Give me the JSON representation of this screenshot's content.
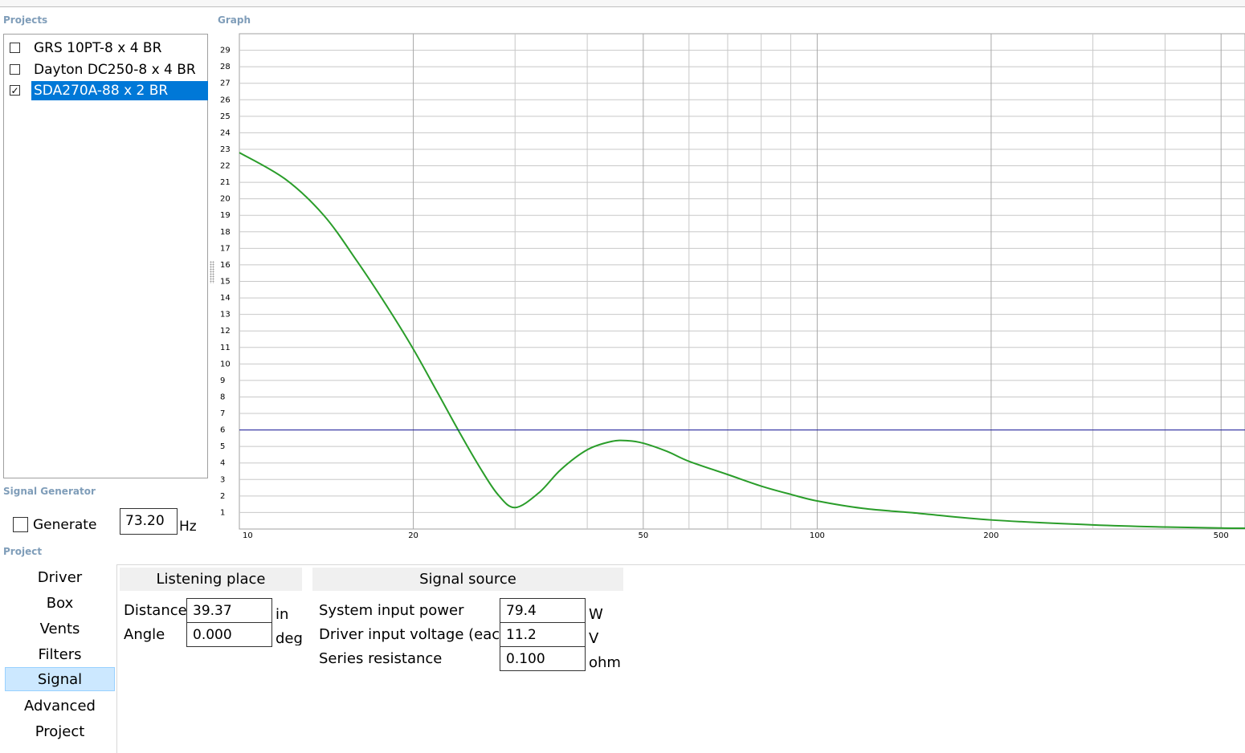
{
  "projects_panel": {
    "title": "Projects",
    "items": [
      {
        "label": "GRS 10PT-8 x 4 BR",
        "checked": false,
        "selected": false
      },
      {
        "label": "Dayton DC250-8 x 4 BR",
        "checked": false,
        "selected": false
      },
      {
        "label": "SDA270A-88 x 2 BR",
        "checked": true,
        "selected": true
      }
    ]
  },
  "graph_panel": {
    "title": "Graph"
  },
  "signal_generator": {
    "title": "Signal Generator",
    "generate_label": "Generate",
    "generate_checked": false,
    "frequency": "73.20",
    "frequency_unit": "Hz"
  },
  "project_panel": {
    "title": "Project",
    "nav": [
      "Driver",
      "Box",
      "Vents",
      "Filters",
      "Signal",
      "Advanced",
      "Project"
    ],
    "active_nav": "Signal",
    "listening_place": {
      "header": "Listening place",
      "distance_label": "Distance",
      "distance_value": "39.37",
      "distance_unit": "in",
      "angle_label": "Angle",
      "angle_value": "0.000",
      "angle_unit": "deg"
    },
    "signal_source": {
      "header": "Signal source",
      "power_label": "System input power",
      "power_value": "79.4",
      "power_unit": "W",
      "voltage_label": "Driver input voltage (each)",
      "voltage_value": "11.2",
      "voltage_unit": "V",
      "resistance_label": "Series resistance",
      "resistance_value": "0.100",
      "resistance_unit": "ohm"
    }
  },
  "chart_data": {
    "type": "line",
    "xscale": "log",
    "xlim": [
      10,
      550
    ],
    "ylim": [
      0,
      30
    ],
    "x_ticks": [
      10,
      20,
      50,
      100,
      200,
      500
    ],
    "y_ticks": [
      1,
      2,
      3,
      4,
      5,
      6,
      7,
      8,
      9,
      10,
      11,
      12,
      13,
      14,
      15,
      16,
      17,
      18,
      19,
      20,
      21,
      22,
      23,
      24,
      25,
      26,
      27,
      28,
      29
    ],
    "grid": true,
    "series": [
      {
        "color": "#2a9d2a",
        "x": [
          10,
          12,
          14,
          16,
          18,
          20,
          22,
          24,
          26,
          28,
          30,
          33,
          36,
          40,
          44,
          47,
          50,
          55,
          60,
          70,
          80,
          90,
          100,
          120,
          150,
          200,
          300,
          400,
          500,
          550
        ],
        "y": [
          22.8,
          21.2,
          19.0,
          16.2,
          13.5,
          10.9,
          8.3,
          5.9,
          3.8,
          2.1,
          1.3,
          2.2,
          3.6,
          4.8,
          5.3,
          5.35,
          5.2,
          4.7,
          4.1,
          3.3,
          2.6,
          2.1,
          1.7,
          1.25,
          0.95,
          0.55,
          0.25,
          0.12,
          0.06,
          0.05
        ]
      },
      {
        "color": "#1a1a9c",
        "x": [
          10,
          550
        ],
        "y": [
          6,
          6
        ]
      }
    ]
  }
}
